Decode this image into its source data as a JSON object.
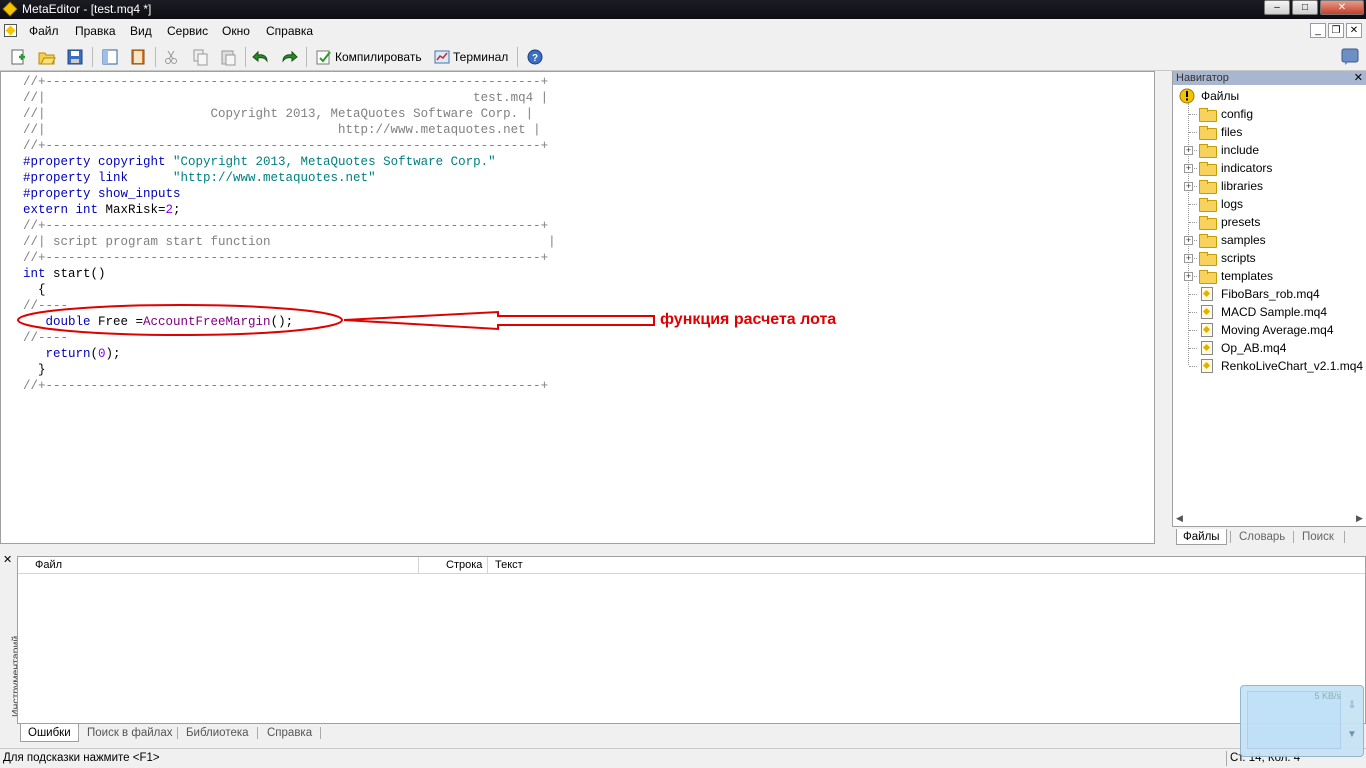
{
  "window": {
    "title": "MetaEditor - [test.mq4 *]"
  },
  "menu": [
    "Файл",
    "Правка",
    "Вид",
    "Сервис",
    "Окно",
    "Справка"
  ],
  "toolbar": {
    "compile_label": "Компилировать",
    "terminal_label": "Терминал"
  },
  "editor": {
    "lines": [
      [
        {
          "c": "cm",
          "t": "//+------------------------------------------------------------------+"
        }
      ],
      [
        {
          "c": "cm",
          "t": "//|                                                         test.mq4 |"
        }
      ],
      [
        {
          "c": "cm",
          "t": "//|                      Copyright 2013, MetaQuotes Software Corp. |"
        }
      ],
      [
        {
          "c": "cm",
          "t": "//|                                       http://www.metaquotes.net |"
        }
      ],
      [
        {
          "c": "cm",
          "t": "//+------------------------------------------------------------------+"
        }
      ],
      [
        {
          "c": "kw",
          "t": "#property copyright "
        },
        {
          "c": "st",
          "t": "\"Copyright 2013, MetaQuotes Software Corp.\""
        }
      ],
      [
        {
          "c": "kw",
          "t": "#property link      "
        },
        {
          "c": "st",
          "t": "\"http://www.metaquotes.net\""
        }
      ],
      [
        {
          "c": "kw",
          "t": "#property show_inputs"
        }
      ],
      [
        {
          "c": "kw",
          "t": "extern int "
        },
        {
          "c": "",
          "t": "MaxRisk="
        },
        {
          "c": "nm",
          "t": "2"
        },
        {
          "c": "",
          "t": ";"
        }
      ],
      [
        {
          "c": "cm",
          "t": "//+------------------------------------------------------------------+"
        }
      ],
      [
        {
          "c": "cm",
          "t": "//| script program start function                                     |"
        }
      ],
      [
        {
          "c": "cm",
          "t": "//+------------------------------------------------------------------+"
        }
      ],
      [
        {
          "c": "kw",
          "t": "int "
        },
        {
          "c": "",
          "t": "start()"
        }
      ],
      [
        {
          "c": "",
          "t": "  {"
        }
      ],
      [
        {
          "c": "cm",
          "t": "//----"
        }
      ],
      [
        {
          "c": "kw",
          "t": "   double "
        },
        {
          "c": "",
          "t": "Free ="
        },
        {
          "c": "fn",
          "t": "AccountFreeMargin"
        },
        {
          "c": "",
          "t": "();"
        }
      ],
      [
        {
          "c": "cm",
          "t": "//----"
        }
      ],
      [
        {
          "c": "kw",
          "t": "   return"
        },
        {
          "c": "",
          "t": "("
        },
        {
          "c": "nm",
          "t": "0"
        },
        {
          "c": "",
          "t": ");"
        }
      ],
      [
        {
          "c": "",
          "t": "  }"
        }
      ],
      [
        {
          "c": "cm",
          "t": "//+------------------------------------------------------------------+"
        }
      ]
    ]
  },
  "annotation": {
    "text": "функция расчета лота"
  },
  "navigator": {
    "title": "Навигатор",
    "root": "Файлы",
    "items": [
      {
        "name": "config",
        "type": "folder",
        "expandable": false
      },
      {
        "name": "files",
        "type": "folder",
        "expandable": false
      },
      {
        "name": "include",
        "type": "folder",
        "expandable": true
      },
      {
        "name": "indicators",
        "type": "folder",
        "expandable": true
      },
      {
        "name": "libraries",
        "type": "folder",
        "expandable": true
      },
      {
        "name": "logs",
        "type": "folder",
        "expandable": false
      },
      {
        "name": "presets",
        "type": "folder",
        "expandable": false
      },
      {
        "name": "samples",
        "type": "folder",
        "expandable": true
      },
      {
        "name": "scripts",
        "type": "folder",
        "expandable": true
      },
      {
        "name": "templates",
        "type": "folder",
        "expandable": true
      },
      {
        "name": "FiboBars_rob.mq4",
        "type": "file",
        "expandable": false
      },
      {
        "name": "MACD Sample.mq4",
        "type": "file",
        "expandable": false
      },
      {
        "name": "Moving Average.mq4",
        "type": "file",
        "expandable": false
      },
      {
        "name": "Op_AB.mq4",
        "type": "file",
        "expandable": false
      },
      {
        "name": "RenkoLiveChart_v2.1.mq4",
        "type": "file",
        "expandable": false
      }
    ],
    "tabs": [
      "Файлы",
      "Словарь",
      "Поиск"
    ]
  },
  "toolbox": {
    "title": "Инструментарий",
    "columns": [
      "Файл",
      "Строка",
      "Текст"
    ],
    "tabs": [
      "Ошибки",
      "Поиск в файлах",
      "Библиотека",
      "Справка"
    ]
  },
  "status": {
    "hint": "Для подсказки нажмите <F1>",
    "position": "Ст. 14, Кол. 4"
  },
  "net_widget": {
    "speed": "5 KB/s"
  }
}
